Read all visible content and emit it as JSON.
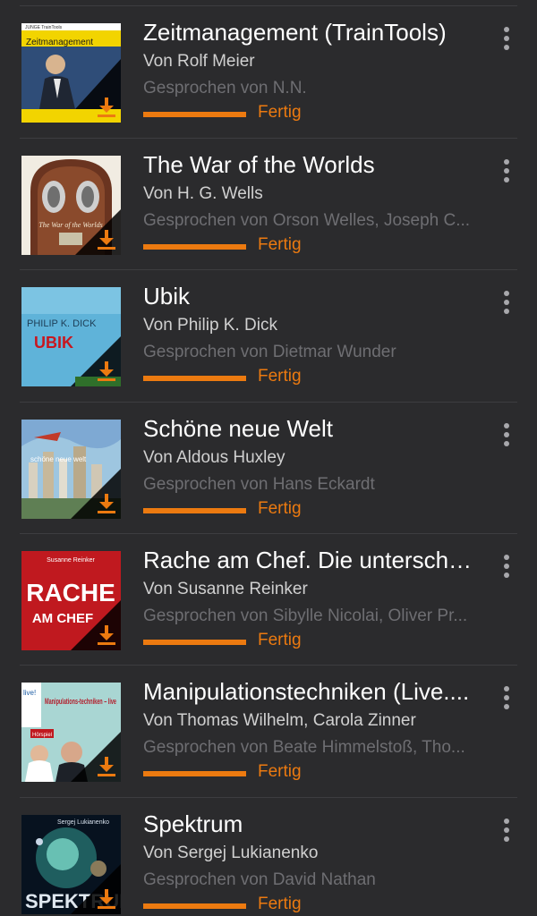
{
  "colors": {
    "background": "#2b2b2d",
    "accent": "#ec7a10",
    "title": "#ffffff",
    "author": "#d0d0d0",
    "narrator": "#6e6e72"
  },
  "items": [
    {
      "title": "Zeitmanagement (TrainTools)",
      "author": "Von Rolf Meier",
      "narrator": "Gesprochen von N.N.",
      "status": "Fertig",
      "progress": 1.0,
      "cover": {
        "text": "Zeitmanagement",
        "publisher": "JUNGE TrainTools"
      }
    },
    {
      "title": "The War of the Worlds",
      "author": "Von H. G. Wells",
      "narrator": "Gesprochen von Orson Welles, Joseph C...",
      "status": "Fertig",
      "progress": 1.0,
      "cover": {
        "text": "The War of the Worlds"
      }
    },
    {
      "title": "Ubik",
      "author": "Von Philip K. Dick",
      "narrator": "Gesprochen von Dietmar Wunder",
      "status": "Fertig",
      "progress": 1.0,
      "cover": {
        "text": "PHILIP K. DICK",
        "subtext": "UBIK"
      }
    },
    {
      "title": "Schöne neue Welt",
      "author": "Von Aldous Huxley",
      "narrator": "Gesprochen von Hans Eckardt",
      "status": "Fertig",
      "progress": 1.0,
      "cover": {
        "text": "schöne neue welt"
      }
    },
    {
      "title": "Rache am Chef. Die unterschät...",
      "author": "Von Susanne Reinker",
      "narrator": "Gesprochen von Sibylle Nicolai, Oliver Pr...",
      "status": "Fertig",
      "progress": 1.0,
      "cover": {
        "text": "RACHE",
        "subtext": "AM CHEF",
        "author": "Susanne Reinker"
      }
    },
    {
      "title": "Manipulationstechniken (Live....",
      "author": "Von Thomas Wilhelm, Carola Zinner",
      "narrator": "Gesprochen von Beate Himmelstoß, Tho...",
      "status": "Fertig",
      "progress": 1.0,
      "cover": {
        "text": "Manipulations-techniken – live",
        "badge": "live!",
        "tag": "Hörspiel"
      }
    },
    {
      "title": "Spektrum",
      "author": "Von Sergej Lukianenko",
      "narrator": "Gesprochen von David Nathan",
      "status": "Fertig",
      "progress": 1.0,
      "cover": {
        "text": "SPEKTRUM",
        "author": "Sergej Lukianenko"
      }
    }
  ]
}
